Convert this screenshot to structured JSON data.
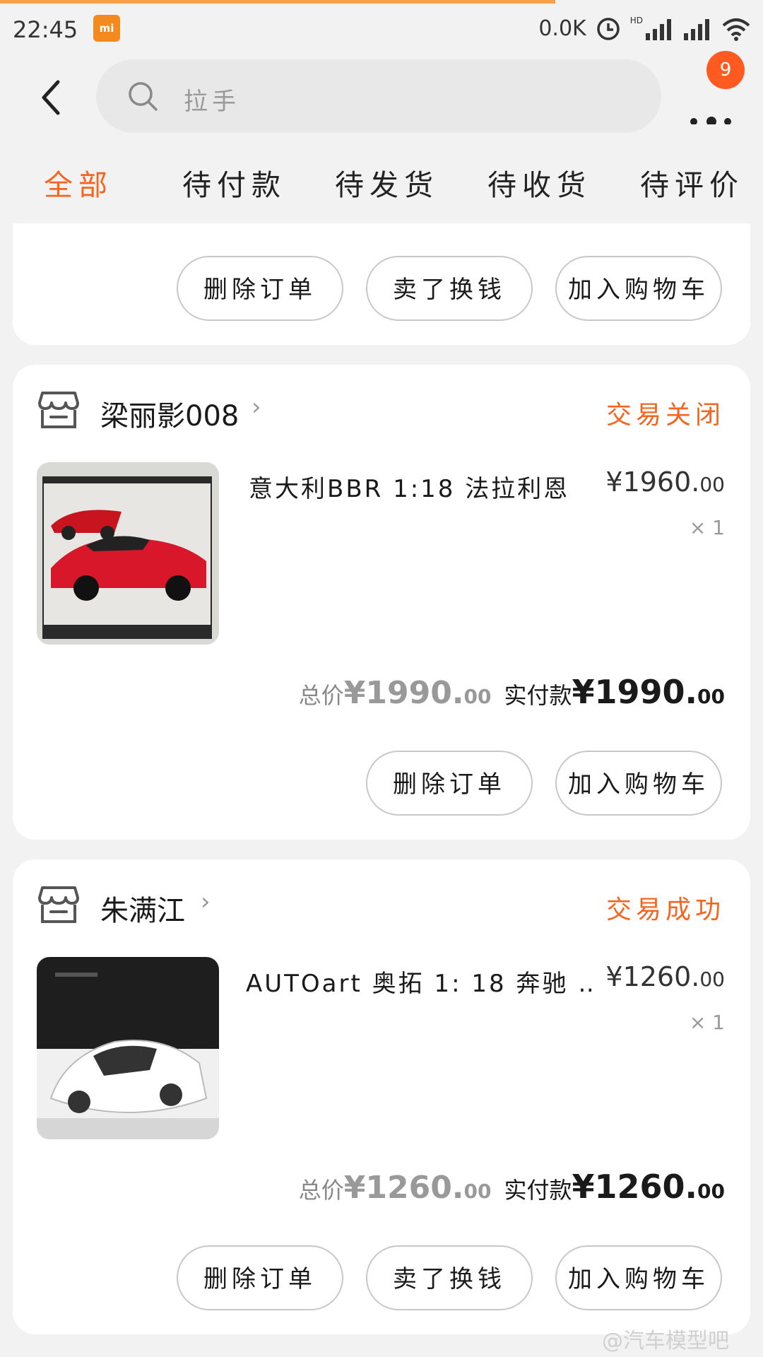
{
  "status_bar": {
    "time": "22:45",
    "network_speed": "0.0K",
    "hd": "HD"
  },
  "header": {
    "search_placeholder": "拉手",
    "notification_count": "9"
  },
  "tabs": [
    "全部",
    "待付款",
    "待发货",
    "待收货",
    "待评价"
  ],
  "colors": {
    "accent": "#f4651f",
    "badge": "#ff5a1f",
    "progress": "#f5a04a"
  },
  "orders": [
    {
      "buttons": [
        "删除订单",
        "卖了换钱",
        "加入购物车"
      ]
    },
    {
      "shop": "梁丽影008",
      "status": "交易关闭",
      "title": "意大利BBR 1:18 法拉利恩 …",
      "price_int": "¥1960.",
      "price_dec": "00",
      "qty": "× 1",
      "total_label": "总价",
      "total_int": "¥1990.",
      "total_dec": "00",
      "paid_label": "实付款",
      "paid_int": "¥1990.",
      "paid_dec": "00",
      "buttons": [
        "删除订单",
        "加入购物车"
      ]
    },
    {
      "shop": "朱满江",
      "status": "交易成功",
      "title": "AUTOart 奥拓 1: 18 奔驰 …",
      "price_int": "¥1260.",
      "price_dec": "00",
      "qty": "× 1",
      "total_label": "总价",
      "total_int": "¥1260.",
      "total_dec": "00",
      "paid_label": "实付款",
      "paid_int": "¥1260.",
      "paid_dec": "00",
      "buttons": [
        "删除订单",
        "卖了换钱",
        "加入购物车"
      ]
    }
  ],
  "watermark": "@汽车模型吧"
}
